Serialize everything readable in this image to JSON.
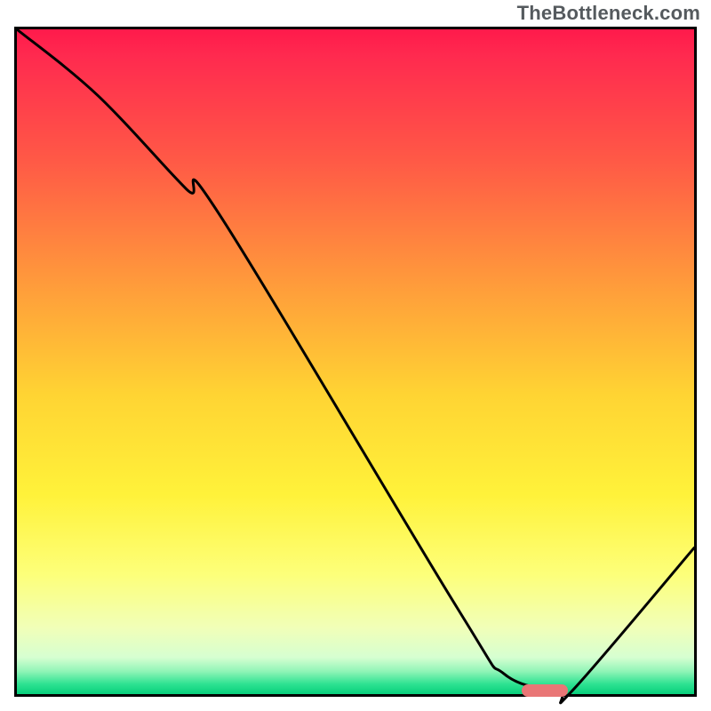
{
  "watermark": "TheBottleneck.com",
  "chart_data": {
    "type": "line",
    "title": "",
    "xlabel": "",
    "ylabel": "",
    "xlim": [
      0,
      100
    ],
    "ylim": [
      0,
      100
    ],
    "x": [
      0,
      12,
      25,
      30,
      65,
      72,
      80,
      82,
      100
    ],
    "values": [
      100,
      90,
      76,
      72,
      13,
      3,
      0.5,
      0.5,
      22
    ],
    "annotations": [
      {
        "kind": "valley-marker",
        "x": 78,
        "y": 0.5
      }
    ],
    "background_gradient": {
      "stops": [
        {
          "offset": 0,
          "color": "#ff1a4b"
        },
        {
          "offset": 0.04,
          "color": "#ff2a4f"
        },
        {
          "offset": 0.2,
          "color": "#ff5a46"
        },
        {
          "offset": 0.4,
          "color": "#ffa13a"
        },
        {
          "offset": 0.55,
          "color": "#ffd433"
        },
        {
          "offset": 0.7,
          "color": "#fff23a"
        },
        {
          "offset": 0.82,
          "color": "#fdff7a"
        },
        {
          "offset": 0.9,
          "color": "#f1ffb8"
        },
        {
          "offset": 0.945,
          "color": "#d6ffd1"
        },
        {
          "offset": 0.965,
          "color": "#93f5b8"
        },
        {
          "offset": 0.985,
          "color": "#2de291"
        },
        {
          "offset": 1.0,
          "color": "#08cf7c"
        }
      ]
    }
  }
}
